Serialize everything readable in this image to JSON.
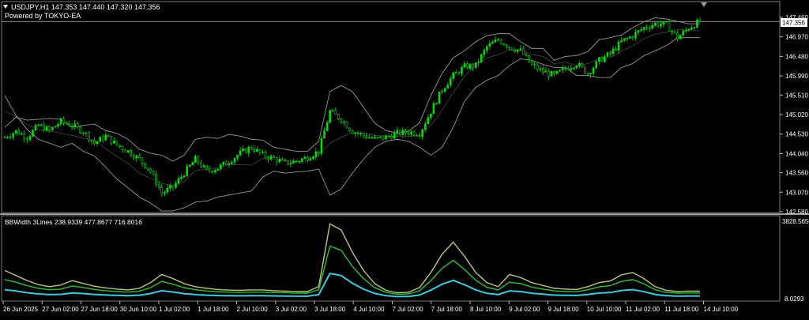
{
  "header": {
    "title": "USDJPY,H1  147.353 147.440 147.320 147.356",
    "subtitle": "Powered by TOKYO-EA"
  },
  "indicator": {
    "label": "BBWidth 3Lines 238.9339 477.8677 716.8016",
    "max_label": "3828.5650",
    "min_label": "8.0293"
  },
  "current_price": {
    "label": "147.356",
    "value": 147.356
  },
  "colors": {
    "background": "#000000",
    "up_candle": "#00e000",
    "band": "#a9a9a9",
    "cur_line": "#c0c0c0",
    "line_outer": "#b8c878",
    "line_mid": "#30c030",
    "line_inner": "#40c8e0"
  },
  "chart_data": [
    {
      "type": "line",
      "title": "",
      "ylim": [
        142.58,
        147.46
      ],
      "price_ticks": [
        "147.460",
        "146.970",
        "146.480",
        "145.990",
        "145.510",
        "145.020",
        "144.530",
        "144.040",
        "143.560",
        "143.070",
        "142.580"
      ],
      "date_ticks": [
        "26 Jun 2025",
        "27 Jun 02:00",
        "27 Jun 18:00",
        "30 Jun 10:00",
        "1 Jul 02:00",
        "1 Jul 18:00",
        "2 Jul 10:00",
        "3 Jul 02:00",
        "3 Jul 18:00",
        "4 Jul 10:00",
        "7 Jul 02:00",
        "7 Jul 18:00",
        "8 Jul 10:00",
        "9 Jul 02:00",
        "9 Jul 18:00",
        "10 Jul 10:00",
        "11 Jul 02:00",
        "11 Jul 18:00",
        "14 Jul 10:00"
      ],
      "close": [
        144.45,
        144.6,
        144.45,
        144.75,
        144.62,
        144.85,
        144.75,
        144.6,
        144.3,
        144.48,
        144.25,
        144.1,
        143.9,
        143.6,
        143.05,
        143.2,
        143.55,
        143.9,
        143.6,
        143.68,
        143.85,
        144.05,
        144.2,
        144.0,
        143.92,
        143.8,
        143.85,
        143.95,
        144.1,
        145.1,
        144.9,
        144.6,
        144.5,
        144.4,
        144.45,
        144.55,
        144.58,
        144.55,
        145.1,
        145.65,
        146.0,
        146.22,
        146.25,
        146.72,
        146.9,
        146.72,
        146.62,
        146.25,
        146.1,
        146.0,
        146.18,
        146.3,
        146.05,
        146.38,
        146.55,
        146.85,
        147.0,
        147.2,
        147.3,
        147.28,
        146.95,
        147.2,
        147.36
      ],
      "bb_upper": [
        144.7,
        144.95,
        144.88,
        144.9,
        144.92,
        144.9,
        144.7,
        144.75,
        144.78,
        144.62,
        144.55,
        144.4,
        144.15,
        144.05,
        144.0,
        143.85,
        144.0,
        144.4,
        144.45,
        144.42,
        144.52,
        144.48,
        144.4,
        144.38,
        144.2,
        144.15,
        144.1,
        144.1,
        144.35,
        145.6,
        145.75,
        145.6,
        145.2,
        144.8,
        144.62,
        144.55,
        144.6,
        144.82,
        145.5,
        146.05,
        146.45,
        146.62,
        146.85,
        147.0,
        147.05,
        147.05,
        146.85,
        146.68,
        146.68,
        146.38,
        146.48,
        146.5,
        146.6,
        146.9,
        146.95,
        147.02,
        147.2,
        147.35,
        147.45,
        147.42,
        147.36,
        147.3,
        147.3
      ],
      "bb_lower": [
        145.5,
        145.0,
        144.65,
        144.4,
        144.3,
        144.2,
        144.3,
        144.1,
        143.98,
        143.7,
        143.4,
        143.18,
        142.95,
        142.8,
        142.6,
        142.6,
        142.68,
        142.82,
        142.85,
        142.95,
        143.0,
        143.05,
        143.1,
        143.45,
        143.6,
        143.55,
        143.58,
        143.6,
        143.65,
        143.0,
        143.15,
        143.55,
        143.9,
        144.2,
        144.35,
        144.4,
        144.35,
        144.2,
        144.0,
        144.2,
        144.7,
        145.35,
        145.7,
        145.88,
        146.0,
        146.25,
        146.42,
        146.38,
        146.28,
        146.2,
        146.2,
        146.0,
        146.0,
        145.95,
        145.95,
        146.2,
        146.3,
        146.5,
        146.62,
        146.75,
        146.95,
        146.95,
        146.95
      ]
    },
    {
      "type": "line",
      "title": "",
      "ylim": [
        8.0293,
        3828.565
      ],
      "series": [
        {
          "name": "",
          "values": [
            1400,
            1150,
            900,
            700,
            600,
            680,
            900,
            760,
            620,
            540,
            480,
            440,
            520,
            800,
            1200,
            1000,
            750,
            600,
            520,
            460,
            430,
            420,
            440,
            440,
            400,
            380,
            360,
            360,
            600,
            3700,
            3400,
            2300,
            1400,
            750,
            420,
            300,
            320,
            560,
            1300,
            2200,
            2800,
            2100,
            1300,
            800,
            600,
            1200,
            1050,
            800,
            660,
            520,
            480,
            460,
            600,
            800,
            880,
            1180,
            1300,
            1000,
            600,
            420,
            360,
            380,
            380
          ]
        },
        {
          "name": "",
          "values": [
            950,
            820,
            650,
            520,
            450,
            480,
            630,
            560,
            460,
            400,
            360,
            330,
            380,
            550,
            860,
            720,
            550,
            450,
            390,
            350,
            330,
            320,
            330,
            330,
            310,
            300,
            280,
            280,
            450,
            2600,
            2400,
            1600,
            1000,
            550,
            320,
            230,
            240,
            400,
            900,
            1500,
            1900,
            1450,
            920,
            570,
            440,
            820,
            750,
            580,
            480,
            390,
            360,
            350,
            450,
            590,
            650,
            860,
            950,
            740,
            450,
            320,
            280,
            290,
            290
          ]
        },
        {
          "name": "",
          "values": [
            450,
            390,
            300,
            240,
            210,
            220,
            290,
            260,
            215,
            190,
            170,
            158,
            178,
            260,
            400,
            335,
            255,
            210,
            180,
            162,
            152,
            148,
            152,
            152,
            144,
            138,
            130,
            130,
            210,
            1250,
            1150,
            770,
            480,
            265,
            155,
            110,
            115,
            190,
            430,
            720,
            910,
            700,
            440,
            272,
            210,
            390,
            360,
            278,
            230,
            186,
            172,
            168,
            215,
            282,
            312,
            412,
            455,
            355,
            215,
            154,
            134,
            140,
            140
          ]
        }
      ]
    }
  ]
}
